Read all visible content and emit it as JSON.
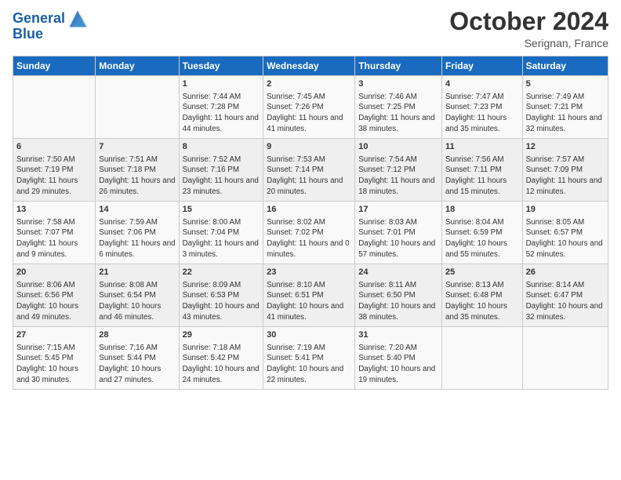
{
  "header": {
    "logo_line1": "General",
    "logo_line2": "Blue",
    "month": "October 2024",
    "location": "Serignan, France"
  },
  "columns": [
    "Sunday",
    "Monday",
    "Tuesday",
    "Wednesday",
    "Thursday",
    "Friday",
    "Saturday"
  ],
  "weeks": [
    [
      {
        "day": "",
        "info": ""
      },
      {
        "day": "",
        "info": ""
      },
      {
        "day": "1",
        "info": "Sunrise: 7:44 AM\nSunset: 7:28 PM\nDaylight: 11 hours and 44 minutes."
      },
      {
        "day": "2",
        "info": "Sunrise: 7:45 AM\nSunset: 7:26 PM\nDaylight: 11 hours and 41 minutes."
      },
      {
        "day": "3",
        "info": "Sunrise: 7:46 AM\nSunset: 7:25 PM\nDaylight: 11 hours and 38 minutes."
      },
      {
        "day": "4",
        "info": "Sunrise: 7:47 AM\nSunset: 7:23 PM\nDaylight: 11 hours and 35 minutes."
      },
      {
        "day": "5",
        "info": "Sunrise: 7:49 AM\nSunset: 7:21 PM\nDaylight: 11 hours and 32 minutes."
      }
    ],
    [
      {
        "day": "6",
        "info": "Sunrise: 7:50 AM\nSunset: 7:19 PM\nDaylight: 11 hours and 29 minutes."
      },
      {
        "day": "7",
        "info": "Sunrise: 7:51 AM\nSunset: 7:18 PM\nDaylight: 11 hours and 26 minutes."
      },
      {
        "day": "8",
        "info": "Sunrise: 7:52 AM\nSunset: 7:16 PM\nDaylight: 11 hours and 23 minutes."
      },
      {
        "day": "9",
        "info": "Sunrise: 7:53 AM\nSunset: 7:14 PM\nDaylight: 11 hours and 20 minutes."
      },
      {
        "day": "10",
        "info": "Sunrise: 7:54 AM\nSunset: 7:12 PM\nDaylight: 11 hours and 18 minutes."
      },
      {
        "day": "11",
        "info": "Sunrise: 7:56 AM\nSunset: 7:11 PM\nDaylight: 11 hours and 15 minutes."
      },
      {
        "day": "12",
        "info": "Sunrise: 7:57 AM\nSunset: 7:09 PM\nDaylight: 11 hours and 12 minutes."
      }
    ],
    [
      {
        "day": "13",
        "info": "Sunrise: 7:58 AM\nSunset: 7:07 PM\nDaylight: 11 hours and 9 minutes."
      },
      {
        "day": "14",
        "info": "Sunrise: 7:59 AM\nSunset: 7:06 PM\nDaylight: 11 hours and 6 minutes."
      },
      {
        "day": "15",
        "info": "Sunrise: 8:00 AM\nSunset: 7:04 PM\nDaylight: 11 hours and 3 minutes."
      },
      {
        "day": "16",
        "info": "Sunrise: 8:02 AM\nSunset: 7:02 PM\nDaylight: 11 hours and 0 minutes."
      },
      {
        "day": "17",
        "info": "Sunrise: 8:03 AM\nSunset: 7:01 PM\nDaylight: 10 hours and 57 minutes."
      },
      {
        "day": "18",
        "info": "Sunrise: 8:04 AM\nSunset: 6:59 PM\nDaylight: 10 hours and 55 minutes."
      },
      {
        "day": "19",
        "info": "Sunrise: 8:05 AM\nSunset: 6:57 PM\nDaylight: 10 hours and 52 minutes."
      }
    ],
    [
      {
        "day": "20",
        "info": "Sunrise: 8:06 AM\nSunset: 6:56 PM\nDaylight: 10 hours and 49 minutes."
      },
      {
        "day": "21",
        "info": "Sunrise: 8:08 AM\nSunset: 6:54 PM\nDaylight: 10 hours and 46 minutes."
      },
      {
        "day": "22",
        "info": "Sunrise: 8:09 AM\nSunset: 6:53 PM\nDaylight: 10 hours and 43 minutes."
      },
      {
        "day": "23",
        "info": "Sunrise: 8:10 AM\nSunset: 6:51 PM\nDaylight: 10 hours and 41 minutes."
      },
      {
        "day": "24",
        "info": "Sunrise: 8:11 AM\nSunset: 6:50 PM\nDaylight: 10 hours and 38 minutes."
      },
      {
        "day": "25",
        "info": "Sunrise: 8:13 AM\nSunset: 6:48 PM\nDaylight: 10 hours and 35 minutes."
      },
      {
        "day": "26",
        "info": "Sunrise: 8:14 AM\nSunset: 6:47 PM\nDaylight: 10 hours and 32 minutes."
      }
    ],
    [
      {
        "day": "27",
        "info": "Sunrise: 7:15 AM\nSunset: 5:45 PM\nDaylight: 10 hours and 30 minutes."
      },
      {
        "day": "28",
        "info": "Sunrise: 7:16 AM\nSunset: 5:44 PM\nDaylight: 10 hours and 27 minutes."
      },
      {
        "day": "29",
        "info": "Sunrise: 7:18 AM\nSunset: 5:42 PM\nDaylight: 10 hours and 24 minutes."
      },
      {
        "day": "30",
        "info": "Sunrise: 7:19 AM\nSunset: 5:41 PM\nDaylight: 10 hours and 22 minutes."
      },
      {
        "day": "31",
        "info": "Sunrise: 7:20 AM\nSunset: 5:40 PM\nDaylight: 10 hours and 19 minutes."
      },
      {
        "day": "",
        "info": ""
      },
      {
        "day": "",
        "info": ""
      }
    ]
  ]
}
